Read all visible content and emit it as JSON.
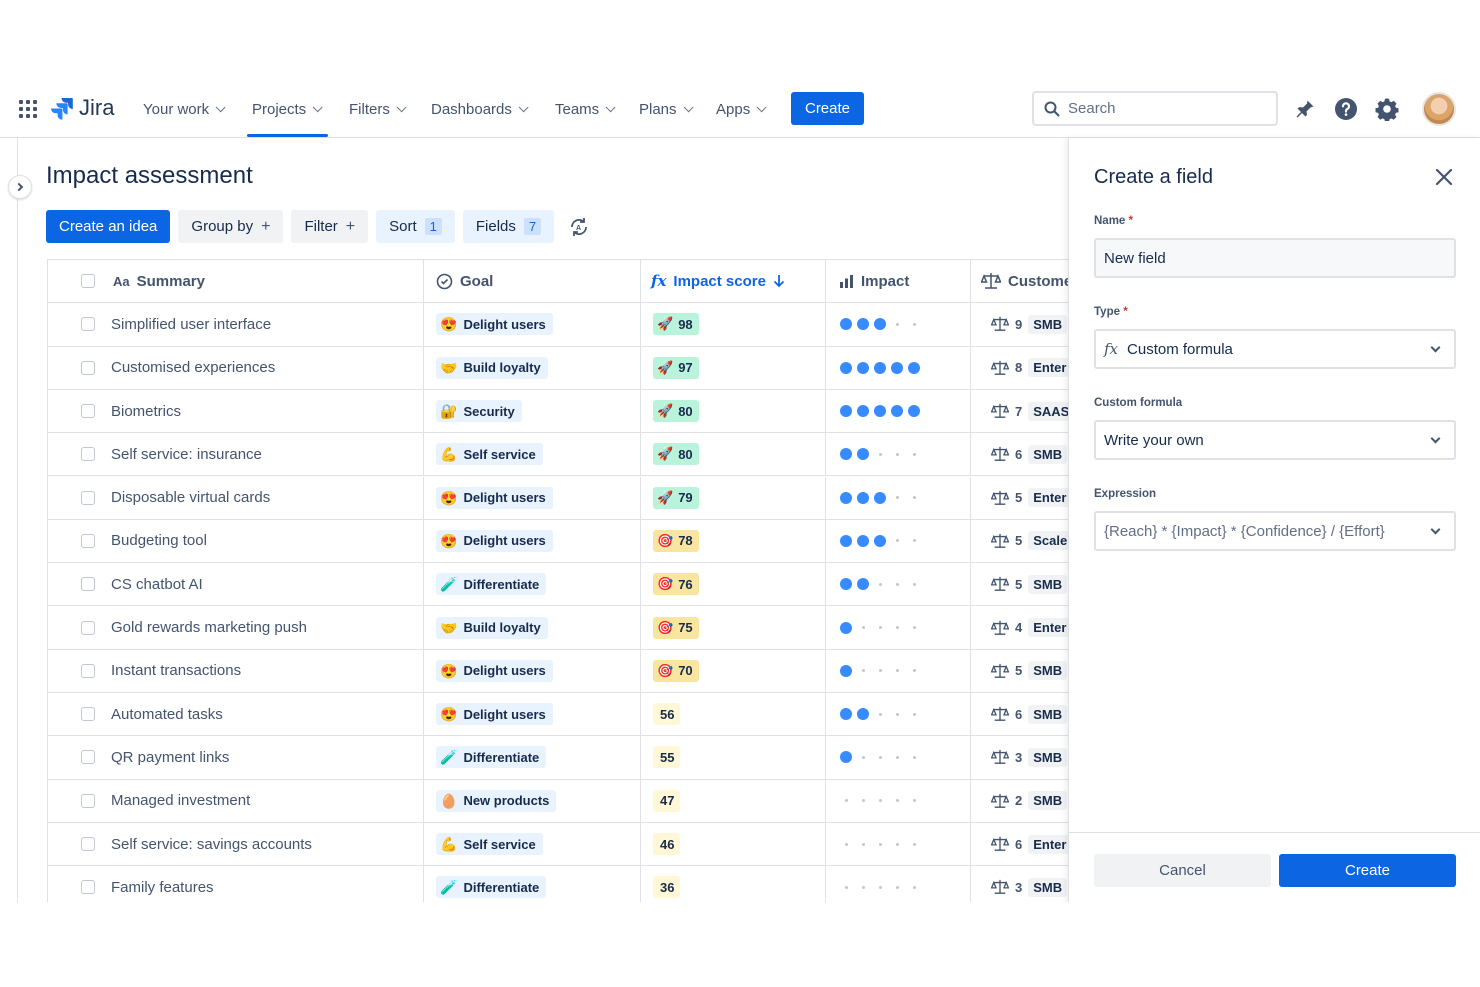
{
  "nav": {
    "brand": "Jira",
    "items": [
      {
        "label": "Your work"
      },
      {
        "label": "Projects"
      },
      {
        "label": "Filters"
      },
      {
        "label": "Dashboards"
      },
      {
        "label": "Teams"
      },
      {
        "label": "Plans"
      },
      {
        "label": "Apps"
      }
    ],
    "create_label": "Create",
    "search_placeholder": "Search"
  },
  "page": {
    "title": "Impact assessment",
    "toolbar": {
      "create_idea": "Create an idea",
      "group_by": "Group by",
      "filter": "Filter",
      "sort": "Sort",
      "sort_count": "1",
      "fields": "Fields",
      "fields_count": "7"
    }
  },
  "table": {
    "headers": {
      "summary_icon": "Aa",
      "summary": "Summary",
      "goal": "Goal",
      "score_icon": "fx",
      "score": "Impact score",
      "impact": "Impact",
      "customer": "Customer"
    },
    "rows": [
      {
        "summary": "Simplified user interface",
        "goal": "Delight users",
        "goal_emoji": "😍",
        "score": "98",
        "score_level": "hi",
        "impact": 3,
        "cust_count": "9",
        "segment": "SMB"
      },
      {
        "summary": "Customised experiences",
        "goal": "Build loyalty",
        "goal_emoji": "🤝",
        "score": "97",
        "score_level": "hi",
        "impact": 5,
        "cust_count": "8",
        "segment": "Enter"
      },
      {
        "summary": "Biometrics",
        "goal": "Security",
        "goal_emoji": "🔐",
        "score": "80",
        "score_level": "hi",
        "impact": 5,
        "cust_count": "7",
        "segment": "SAAS"
      },
      {
        "summary": "Self service: insurance",
        "goal": "Self service",
        "goal_emoji": "💪",
        "score": "80",
        "score_level": "hi",
        "impact": 2,
        "cust_count": "6",
        "segment": "SMB"
      },
      {
        "summary": "Disposable virtual cards",
        "goal": "Delight users",
        "goal_emoji": "😍",
        "score": "79",
        "score_level": "hi",
        "impact": 3,
        "cust_count": "5",
        "segment": "Enter"
      },
      {
        "summary": "Budgeting tool",
        "goal": "Delight users",
        "goal_emoji": "😍",
        "score": "78",
        "score_level": "mid",
        "impact": 3,
        "cust_count": "5",
        "segment": "Scale"
      },
      {
        "summary": "CS chatbot AI",
        "goal": "Differentiate",
        "goal_emoji": "🧪",
        "score": "76",
        "score_level": "mid",
        "impact": 2,
        "cust_count": "5",
        "segment": "SMB"
      },
      {
        "summary": "Gold rewards marketing push",
        "goal": "Build loyalty",
        "goal_emoji": "🤝",
        "score": "75",
        "score_level": "mid",
        "impact": 1,
        "cust_count": "4",
        "segment": "Enter"
      },
      {
        "summary": "Instant transactions",
        "goal": "Delight users",
        "goal_emoji": "😍",
        "score": "70",
        "score_level": "mid",
        "impact": 1,
        "cust_count": "5",
        "segment": "SMB"
      },
      {
        "summary": "Automated tasks",
        "goal": "Delight users",
        "goal_emoji": "😍",
        "score": "56",
        "score_level": "lo",
        "impact": 2,
        "cust_count": "6",
        "segment": "SMB"
      },
      {
        "summary": "QR payment links",
        "goal": "Differentiate",
        "goal_emoji": "🧪",
        "score": "55",
        "score_level": "lo",
        "impact": 1,
        "cust_count": "3",
        "segment": "SMB"
      },
      {
        "summary": "Managed investment",
        "goal": "New products",
        "goal_emoji": "🥚",
        "score": "47",
        "score_level": "lo",
        "impact": 0,
        "cust_count": "2",
        "segment": "SMB"
      },
      {
        "summary": "Self service: savings accounts",
        "goal": "Self service",
        "goal_emoji": "💪",
        "score": "46",
        "score_level": "lo",
        "impact": 0,
        "cust_count": "6",
        "segment": "Enter"
      },
      {
        "summary": "Family features",
        "goal": "Differentiate",
        "goal_emoji": "🧪",
        "score": "36",
        "score_level": "lo",
        "impact": 0,
        "cust_count": "3",
        "segment": "SMB"
      }
    ]
  },
  "panel": {
    "title": "Create a field",
    "name_label": "Name",
    "name_value": "New field",
    "type_label": "Type",
    "type_icon": "fx",
    "type_value": "Custom formula",
    "formula_label": "Custom formula",
    "formula_value": "Write your own",
    "expression_label": "Expression",
    "expression_value": "{Reach} * {Impact} * {Confidence} / {Effort}",
    "required_mark": "*",
    "cancel": "Cancel",
    "submit": "Create"
  },
  "colors": {
    "primary": "#0c66e4",
    "impact_dot": "#388bff",
    "score_high": "#baf3db",
    "score_mid": "#f8e6a0",
    "score_low": "#fff7d6"
  }
}
